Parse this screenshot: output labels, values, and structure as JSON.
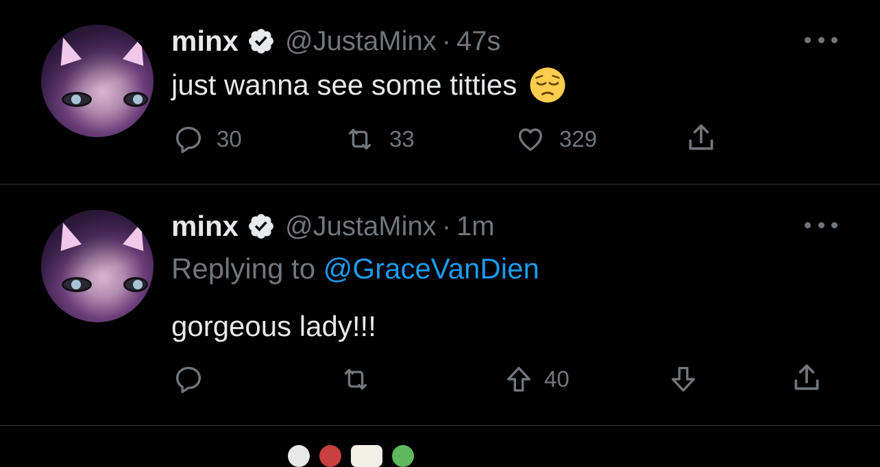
{
  "tweets": [
    {
      "name": "minx",
      "handle": "@JustaMinx",
      "separator": "·",
      "time": "47s",
      "text": "just wanna see some titties",
      "emoji": "pensive-face",
      "actions": {
        "replies": "30",
        "retweets": "33",
        "likes": "329"
      }
    },
    {
      "name": "minx",
      "handle": "@JustaMinx",
      "separator": "·",
      "time": "1m",
      "replying_prefix": "Replying to",
      "replying_to": "@GraceVanDien",
      "text": "gorgeous lady!!!",
      "actions": {
        "upvotes": "40"
      }
    }
  ],
  "colors": {
    "background": "#000000",
    "text": "#e7e9ea",
    "muted": "#71767b",
    "link": "#1d9bf0",
    "divider": "#2f3336"
  }
}
